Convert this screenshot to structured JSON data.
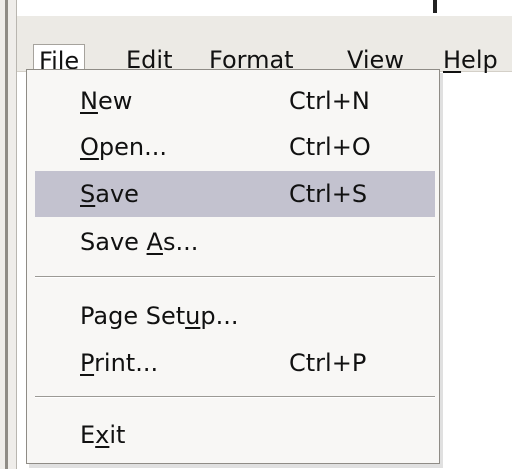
{
  "menubar": {
    "file": {
      "mn": "F",
      "rest": "ile"
    },
    "edit": {
      "mn": "E",
      "rest": "dit"
    },
    "format": {
      "pre": "F",
      "mn": "o",
      "rest": "rmat"
    },
    "view": {
      "mn": "V",
      "rest": "iew"
    },
    "help": {
      "mn": "H",
      "rest": "elp"
    }
  },
  "file_menu": {
    "new": {
      "pre": "",
      "mn": "N",
      "rest": "ew",
      "shortcut": "Ctrl+N"
    },
    "open": {
      "pre": "",
      "mn": "O",
      "rest": "pen...",
      "shortcut": "Ctrl+O"
    },
    "save": {
      "pre": "",
      "mn": "S",
      "rest": "ave",
      "shortcut": "Ctrl+S"
    },
    "save_as": {
      "pre": "Save ",
      "mn": "A",
      "rest": "s...",
      "shortcut": ""
    },
    "page_setup": {
      "pre": "Page Set",
      "mn": "u",
      "rest": "p...",
      "shortcut": ""
    },
    "print": {
      "pre": "",
      "mn": "P",
      "rest": "rint...",
      "shortcut": "Ctrl+P"
    },
    "exit": {
      "pre": "E",
      "mn": "x",
      "rest": "it",
      "shortcut": ""
    }
  },
  "colors": {
    "highlight": "#c3c2cf",
    "menu_background": "#f8f7f5",
    "menubar_background": "#eceae5"
  }
}
